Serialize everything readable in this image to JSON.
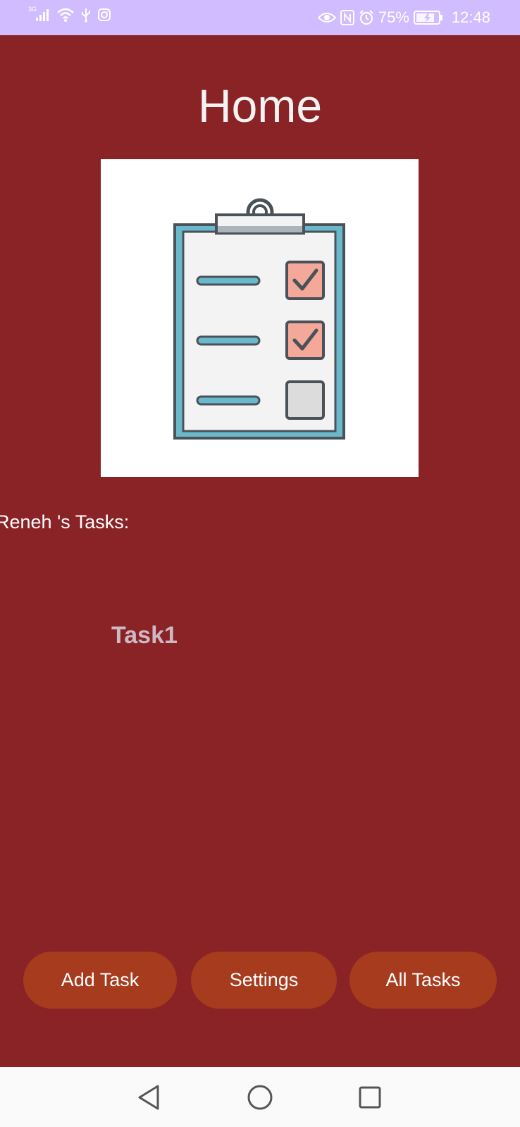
{
  "status_bar": {
    "network_label": "3G",
    "battery_percent": "75%",
    "time": "12:48",
    "left_icons": [
      "signal-icon",
      "wifi-icon",
      "usb-icon",
      "instagram-icon"
    ],
    "right_icons": [
      "eye-icon",
      "nfc-icon",
      "alarm-icon",
      "battery-charging-icon"
    ]
  },
  "page": {
    "title": "Home",
    "hero_image": "clipboard-checklist-icon"
  },
  "tasks": {
    "heading": "Reneh 's Tasks:",
    "items": [
      "Task1"
    ]
  },
  "buttons": {
    "add_task": "Add Task",
    "settings": "Settings",
    "all_tasks": "All Tasks"
  },
  "colors": {
    "background": "#8a2325",
    "status_bar": "#d0bcff",
    "button": "#a73b1e",
    "task_text": "#cdb8c4",
    "nav_bar": "#fafafa"
  },
  "navigation": {
    "icons": [
      "back-icon",
      "home-icon",
      "recent-apps-icon"
    ]
  }
}
